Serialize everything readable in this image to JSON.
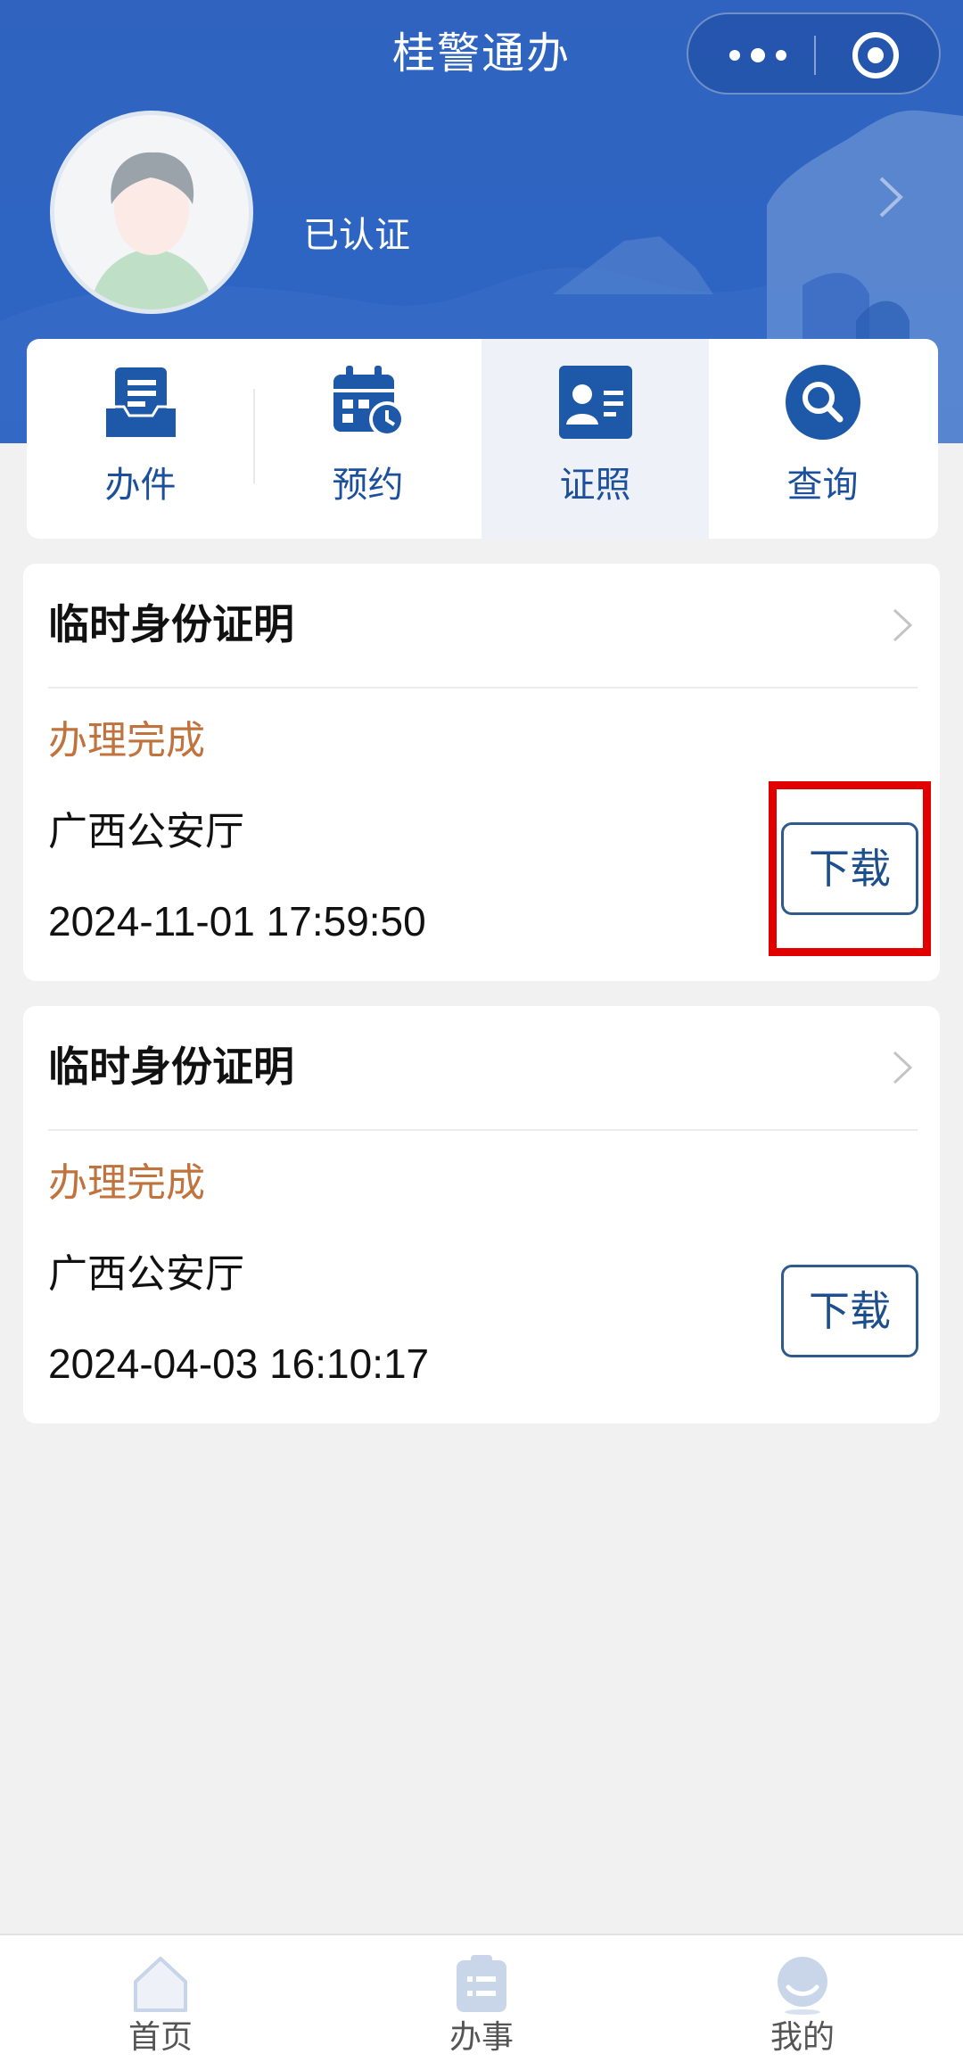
{
  "header": {
    "app_title": "桂警通办",
    "verified_label": "已认证"
  },
  "quick_menu": [
    {
      "label": "办件",
      "icon": "document-tray-icon"
    },
    {
      "label": "预约",
      "icon": "calendar-clock-icon"
    },
    {
      "label": "证照",
      "icon": "id-card-icon",
      "active": true
    },
    {
      "label": "查询",
      "icon": "search-icon"
    }
  ],
  "records": [
    {
      "title": "临时身份证明",
      "status": "办理完成",
      "org": "广西公安厅",
      "time": "2024-11-01 17:59:50",
      "action": "下载"
    },
    {
      "title": "临时身份证明",
      "status": "办理完成",
      "org": "广西公安厅",
      "time": "2024-04-03 16:10:17",
      "action": "下载"
    }
  ],
  "tabbar": [
    {
      "label": "首页",
      "icon": "home-icon"
    },
    {
      "label": "办事",
      "icon": "clipboard-icon"
    },
    {
      "label": "我的",
      "icon": "profile-icon"
    }
  ],
  "colors": {
    "brand_blue": "#2f63bf",
    "status_orange": "#c0733d",
    "highlight_red": "#e00000",
    "button_border": "#2e5a8c"
  }
}
